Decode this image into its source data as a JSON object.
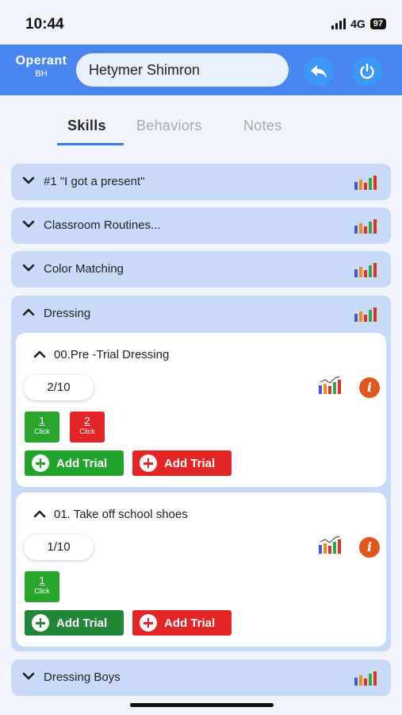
{
  "status": {
    "time": "10:44",
    "network": "4G",
    "battery": "97"
  },
  "header": {
    "logo_main": "Operant",
    "logo_sub": "BH",
    "client_name": "Hetymer Shimron"
  },
  "tabs": [
    {
      "label": "Skills",
      "active": true
    },
    {
      "label": "Behaviors",
      "active": false
    },
    {
      "label": "Notes",
      "active": false
    }
  ],
  "skills": [
    {
      "label": "#1 \"I got a present\""
    },
    {
      "label": "Classroom Routines..."
    },
    {
      "label": "Color Matching"
    },
    {
      "label": "Dressing"
    },
    {
      "label": "Dressing Boys"
    }
  ],
  "dressing_targets": [
    {
      "title": "00.Pre -Trial Dressing",
      "count": "2/10",
      "clicks": [
        {
          "num": "1",
          "label": "Click",
          "color": "#27a52c"
        },
        {
          "num": "2",
          "label": "Click",
          "color": "#e42525"
        }
      ],
      "add_correct_label": "Add Trial",
      "add_incorrect_label": "Add Trial"
    },
    {
      "title": "01. Take off school shoes",
      "count": "1/10",
      "clicks": [
        {
          "num": "1",
          "label": "Click",
          "color": "#27a52c"
        }
      ],
      "add_correct_label": "Add Trial",
      "add_incorrect_label": "Add Trial"
    }
  ],
  "colors": {
    "header_bg": "#4a86f0",
    "row_bg": "#c9daf9",
    "correct_green": "#22a32b",
    "incorrect_red": "#e42525",
    "info_orange": "#e0571b"
  },
  "icons": {
    "back": "reply-arrow-icon",
    "power": "power-icon",
    "chart": "bar-chart-icon",
    "info": "info-icon"
  }
}
